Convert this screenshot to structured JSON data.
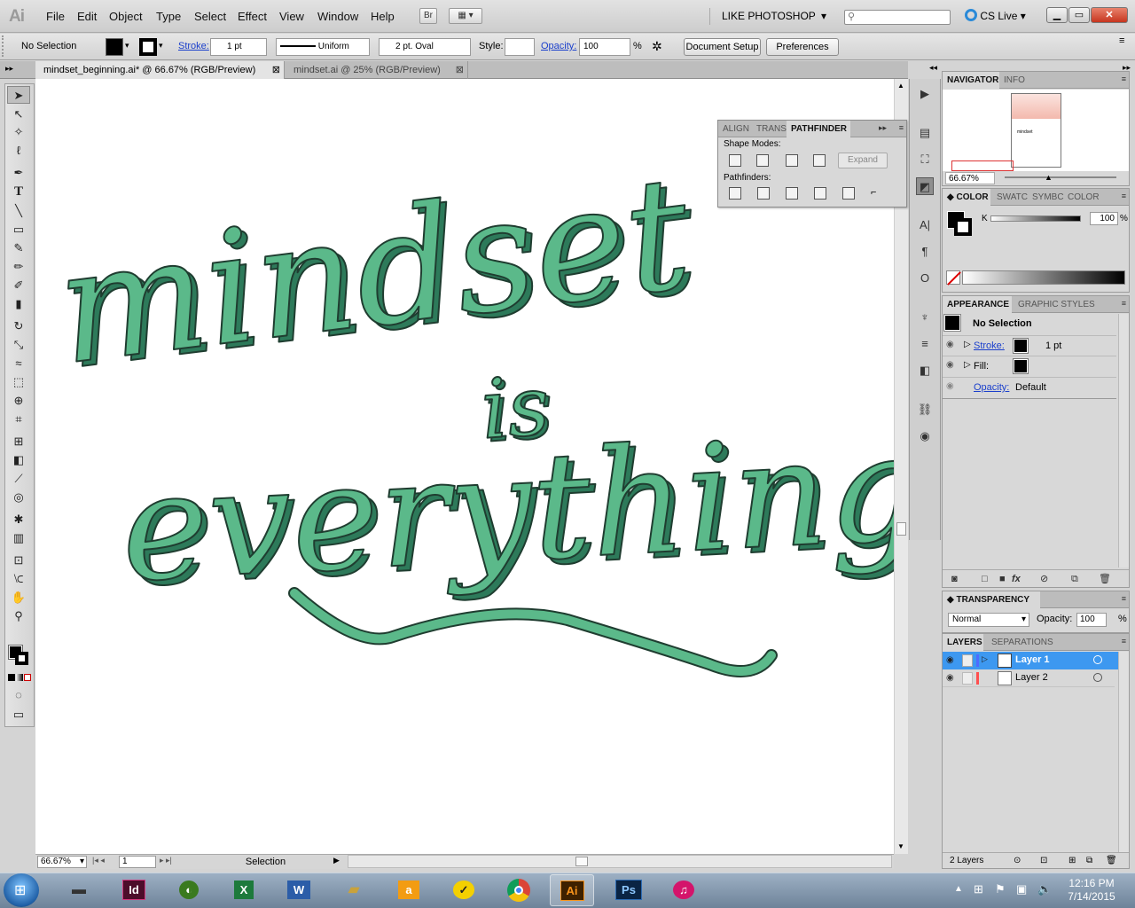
{
  "app": {
    "logo": "Ai"
  },
  "menu": [
    "File",
    "Edit",
    "Object",
    "Type",
    "Select",
    "Effect",
    "View",
    "Window",
    "Help"
  ],
  "app_bar": {
    "bridge": "Br",
    "workspace": "LIKE PHOTOSHOP",
    "cs_live": "CS Live"
  },
  "control": {
    "selection": "No Selection",
    "stroke_label": "Stroke:",
    "stroke_weight": "1 pt",
    "profile": "Uniform",
    "brush": "2 pt. Oval",
    "style_label": "Style:",
    "opacity_label": "Opacity:",
    "opacity": "100",
    "percent": "%",
    "doc_setup": "Document Setup",
    "preferences": "Preferences"
  },
  "tabs": [
    {
      "label": "mindset_beginning.ai* @ 66.67% (RGB/Preview)",
      "active": true
    },
    {
      "label": "mindset.ai @ 25% (RGB/Preview)",
      "active": false
    }
  ],
  "artwork": {
    "words": [
      "mindset",
      "is",
      "everything"
    ],
    "fill": "#5bb98a",
    "shadow": "#2d7a5a",
    "outline": "#1f3d30"
  },
  "pathfinder": {
    "tabs": [
      "ALIGN",
      "TRANS",
      "PATHFINDER"
    ],
    "shape_modes": "Shape Modes:",
    "expand": "Expand",
    "pathfinders": "Pathfinders:"
  },
  "navigator": {
    "tabs": [
      "NAVIGATOR",
      "INFO"
    ],
    "zoom": "66.67%",
    "thumb_text": "mindset"
  },
  "color": {
    "tabs": [
      "COLOR",
      "SWATC",
      "SYMBC",
      "COLOR"
    ],
    "k_label": "K",
    "k_value": "100",
    "percent": "%"
  },
  "appearance": {
    "tabs": [
      "APPEARANCE",
      "GRAPHIC STYLES"
    ],
    "title": "No Selection",
    "stroke_label": "Stroke:",
    "stroke_value": "1 pt",
    "fill_label": "Fill:",
    "opacity_label": "Opacity:",
    "opacity_value": "Default"
  },
  "transparency": {
    "title": "TRANSPARENCY",
    "mode": "Normal",
    "opacity_label": "Opacity:",
    "opacity": "100",
    "percent": "%"
  },
  "layers": {
    "tabs": [
      "LAYERS",
      "SEPARATIONS PREVIEW"
    ],
    "items": [
      {
        "name": "Layer 1",
        "selected": true,
        "color": "#4f6bff"
      },
      {
        "name": "Layer 2",
        "selected": false,
        "color": "#ff4f4f"
      }
    ],
    "count": "2 Layers"
  },
  "status": {
    "zoom": "66.67%",
    "page": "1",
    "tool": "Selection"
  },
  "taskbar": {
    "apps": [
      "Id",
      "Dw",
      "X",
      "W",
      "",
      "a",
      "",
      "",
      "Ai",
      "Ps",
      ""
    ],
    "time": "12:16 PM",
    "date": "7/14/2015"
  },
  "colors": {
    "accent": "#3399ff",
    "ai_orange": "#f7941d",
    "ps_blue": "#2f6db5"
  }
}
